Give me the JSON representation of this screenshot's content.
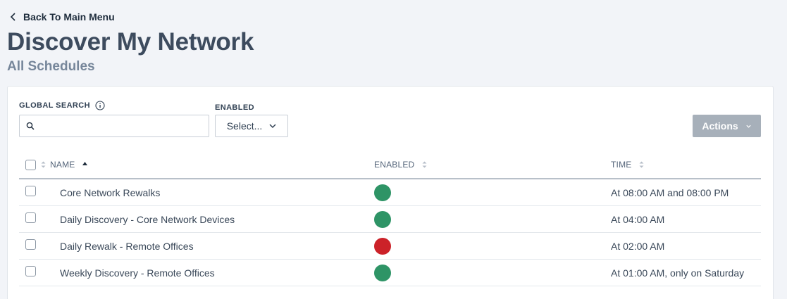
{
  "nav": {
    "back_label": "Back To Main Menu"
  },
  "page": {
    "title": "Discover My Network",
    "subtitle": "All Schedules"
  },
  "filters": {
    "global_search_label": "GLOBAL SEARCH",
    "search_value": "",
    "enabled_label": "ENABLED",
    "enabled_select_value": "Select..."
  },
  "actions": {
    "label": "Actions"
  },
  "table": {
    "columns": [
      "NAME",
      "ENABLED",
      "TIME"
    ],
    "sorted_column": "NAME",
    "sort_direction": "ascending",
    "rows": [
      {
        "name": "Core Network Rewalks",
        "enabled": true,
        "time": "At 08:00 AM and 08:00 PM"
      },
      {
        "name": "Daily Discovery - Core Network Devices",
        "enabled": true,
        "time": "At 04:00 AM"
      },
      {
        "name": "Daily Rewalk - Remote Offices",
        "enabled": false,
        "time": "At 02:00 AM"
      },
      {
        "name": "Weekly Discovery - Remote Offices",
        "enabled": true,
        "time": "At 01:00 AM, only on Saturday"
      }
    ]
  },
  "colors": {
    "enabled": "#2e9466",
    "disabled": "#cc2229",
    "accent_button": "#a7b0ba",
    "title": "#3d4b5e"
  },
  "icons": {
    "back": "chevron-left-icon",
    "info": "info-icon",
    "search": "search-icon",
    "dropdown": "chevron-down-icon",
    "sort": "sort-icon",
    "sort_asc": "sort-ascending-icon"
  }
}
